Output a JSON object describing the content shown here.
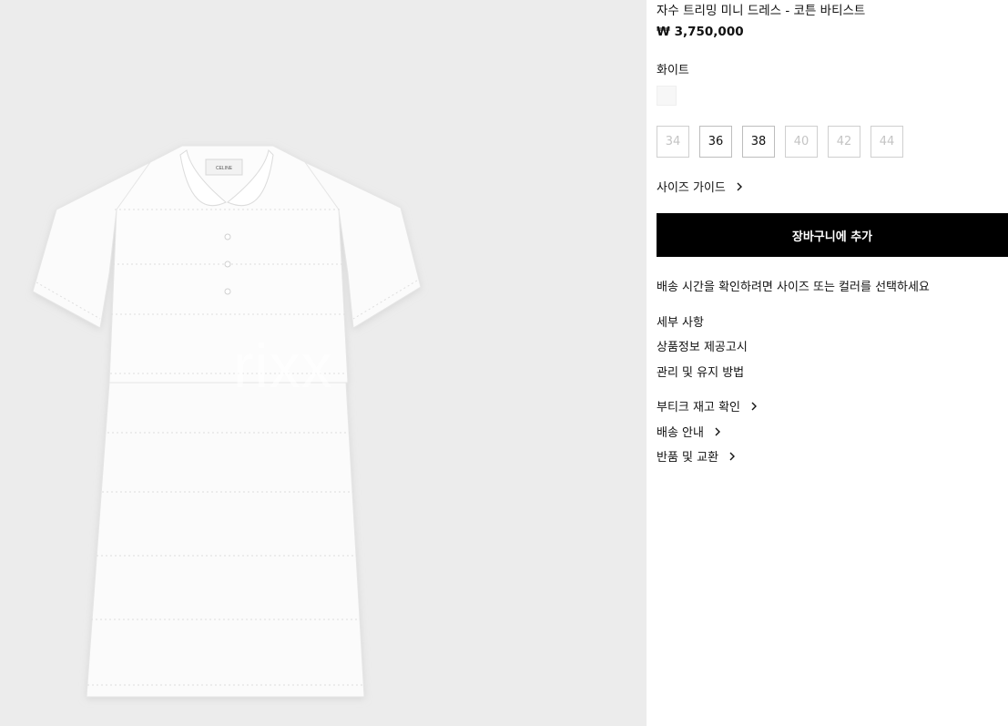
{
  "product": {
    "title": "자수 트리밍 미니 드레스 - 코튼 바티스트",
    "price": "₩ 3,750,000",
    "color_label": "화이트",
    "swatch_color": "#f7f7f7",
    "sizes": [
      {
        "label": "34",
        "available": false
      },
      {
        "label": "36",
        "available": true
      },
      {
        "label": "38",
        "available": true
      },
      {
        "label": "40",
        "available": false
      },
      {
        "label": "42",
        "available": false
      },
      {
        "label": "44",
        "available": false
      }
    ]
  },
  "image": {
    "watermark": "rixx",
    "label_brand": "CELINE",
    "icon": "dress-image"
  },
  "actions": {
    "size_guide": "사이즈 가이드",
    "add_to_cart": "장바구니에 추가",
    "delivery_note": "배송 시간을 확인하려면 사이즈 또는 컬러를 선택하세요"
  },
  "details": {
    "items": [
      "세부 사항",
      "상품정보 제공고시",
      "관리 및 유지 방법"
    ]
  },
  "links": {
    "items": [
      "부티크 재고 확인",
      "배송 안내",
      "반품 및 교환"
    ]
  },
  "colors": {
    "button_bg": "#000000",
    "button_text": "#ffffff",
    "image_bg": "#ececec",
    "disabled_text": "#c4c4c4"
  }
}
